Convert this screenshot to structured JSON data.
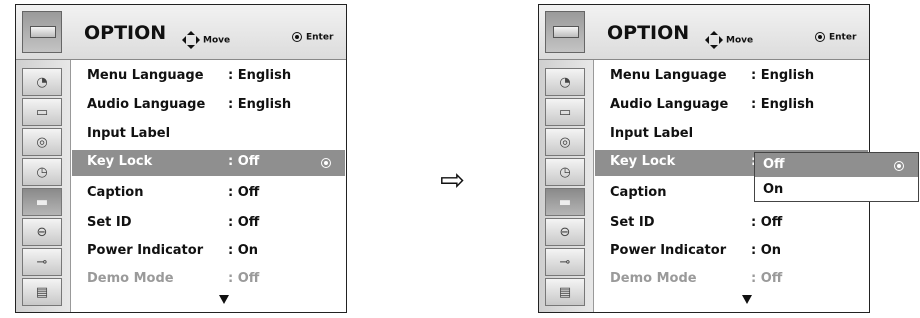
{
  "header": {
    "title": "OPTION",
    "move_label": "Move",
    "enter_label": "Enter"
  },
  "menu": [
    {
      "label": "Menu Language",
      "value": ": English"
    },
    {
      "label": "Audio Language",
      "value": ": English"
    },
    {
      "label": "Input Label",
      "value": ""
    },
    {
      "label": "Key Lock",
      "value": ": Off"
    },
    {
      "label": "Caption",
      "value": ": Off"
    },
    {
      "label": "Set ID",
      "value": ": Off"
    },
    {
      "label": "Power Indicator",
      "value": ": On"
    },
    {
      "label": "Demo Mode",
      "value": ": Off"
    }
  ],
  "right_keylock_value": ":",
  "dropdown": {
    "options": [
      "Off",
      "On"
    ],
    "selected": "Off"
  },
  "sidebar_icons": [
    "satellite-dish-icon",
    "monitor-icon",
    "speaker-icon",
    "clock-icon",
    "option-icon",
    "lock-icon",
    "input-plug-icon",
    "film-clapper-icon"
  ],
  "colors": {
    "selected_row": "#8f8f8f"
  }
}
